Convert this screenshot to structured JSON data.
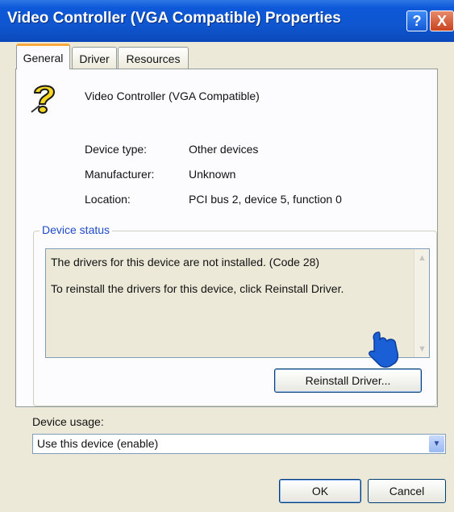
{
  "window": {
    "title": "Video Controller (VGA Compatible) Properties",
    "help_label": "?",
    "close_label": "X"
  },
  "tabs": [
    {
      "label": "General",
      "active": true
    },
    {
      "label": "Driver",
      "active": false
    },
    {
      "label": "Resources",
      "active": false
    }
  ],
  "device": {
    "icon": "unknown-device-question-icon",
    "name": "Video Controller (VGA Compatible)",
    "properties": [
      {
        "label": "Device type:",
        "value": "Other devices"
      },
      {
        "label": "Manufacturer:",
        "value": "Unknown"
      },
      {
        "label": "Location:",
        "value": "PCI bus 2, device 5, function 0"
      }
    ]
  },
  "status": {
    "legend": "Device status",
    "lines": [
      "The drivers for this device are not installed. (Code 28)",
      "To reinstall the drivers for this device, click Reinstall Driver."
    ],
    "reinstall_label": "Reinstall Driver..."
  },
  "usage": {
    "label": "Device usage:",
    "selected": "Use this device (enable)"
  },
  "buttons": {
    "ok": "OK",
    "cancel": "Cancel"
  },
  "colors": {
    "titlebar": "#0d59da",
    "legend": "#1f4bc8",
    "pointer": "#1a5fd6"
  }
}
